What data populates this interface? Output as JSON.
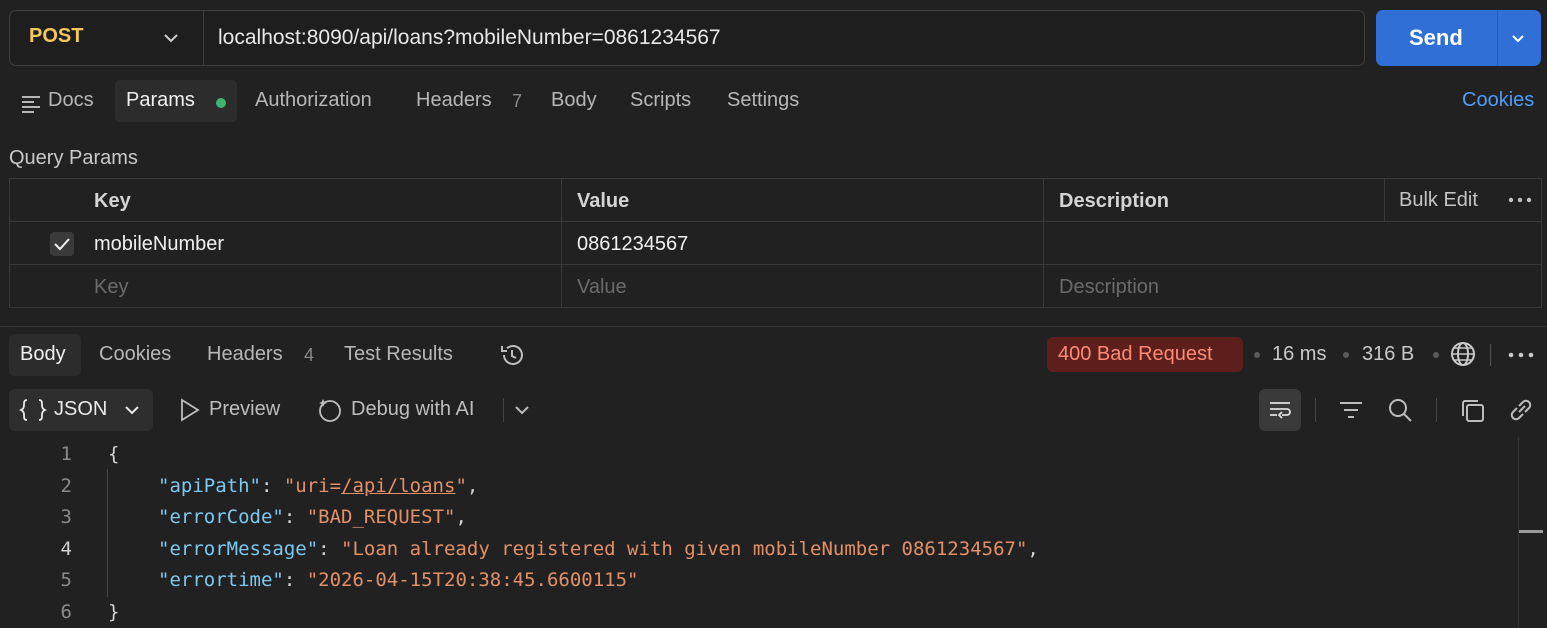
{
  "request": {
    "method": "POST",
    "url": "localhost:8090/api/loans?mobileNumber=0861234567",
    "send_label": "Send"
  },
  "request_tabs": {
    "docs": "Docs",
    "params": "Params",
    "authorization": "Authorization",
    "headers": "Headers",
    "headers_count": "7",
    "body": "Body",
    "scripts": "Scripts",
    "settings": "Settings",
    "cookies": "Cookies"
  },
  "query_params": {
    "title": "Query Params",
    "columns": {
      "key": "Key",
      "value": "Value",
      "description": "Description",
      "bulk_edit": "Bulk Edit"
    },
    "rows": [
      {
        "checked": true,
        "key": "mobileNumber",
        "value": "0861234567",
        "description": ""
      }
    ],
    "placeholder": {
      "key": "Key",
      "value": "Value",
      "description": "Description"
    }
  },
  "response_tabs": {
    "body": "Body",
    "cookies": "Cookies",
    "headers": "Headers",
    "headers_count": "4",
    "test_results": "Test Results"
  },
  "response_meta": {
    "status": "400 Bad Request",
    "time": "16 ms",
    "size": "316 B"
  },
  "toolbar": {
    "format": "JSON",
    "preview": "Preview",
    "debug_ai": "Debug with AI"
  },
  "response_body": {
    "line_numbers": [
      "1",
      "2",
      "3",
      "4",
      "5",
      "6"
    ],
    "open_brace": "{",
    "close_brace": "}",
    "fields": [
      {
        "key": "\"apiPath\"",
        "value_prefix": "\"uri=",
        "value_link": "/api/loans",
        "value_suffix": "\""
      },
      {
        "key": "\"errorCode\"",
        "value": "\"BAD_REQUEST\""
      },
      {
        "key": "\"errorMessage\"",
        "value": "\"Loan already registered with given mobileNumber 0861234567\""
      },
      {
        "key": "\"errortime\"",
        "value": "\"2026-04-15T20:38:45.6600115\""
      }
    ]
  },
  "colors": {
    "method": "#f2c75c",
    "send": "#2f6fd6",
    "link": "#4f9cf5",
    "status_bg": "#5c1f1b",
    "status_text": "#ff8a75",
    "json_key": "#7ec8f0",
    "json_string": "#e29069"
  }
}
